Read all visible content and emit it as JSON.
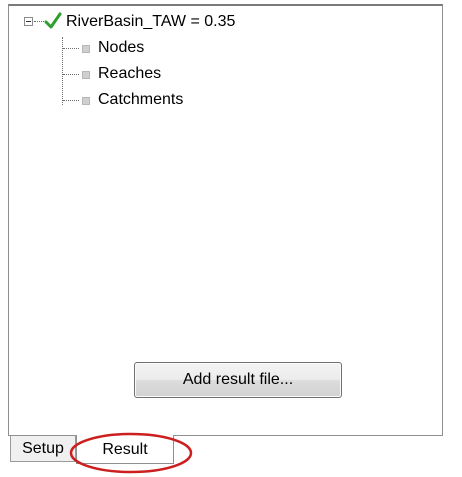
{
  "tree": {
    "root": {
      "label": "RiverBasin_TAW = 0.35",
      "checked": true,
      "check_color": "#2e9e2e",
      "expander": "collapse"
    },
    "children": [
      {
        "label": "Nodes"
      },
      {
        "label": "Reaches"
      },
      {
        "label": "Catchments"
      }
    ]
  },
  "actions": {
    "add_result_label": "Add result file..."
  },
  "tabs": {
    "items": [
      {
        "label": "Setup",
        "selected": false
      },
      {
        "label": "Result",
        "selected": true
      }
    ]
  },
  "annotation": {
    "highlight_color": "#cc1f1f",
    "highlighted_tab": "Result"
  }
}
